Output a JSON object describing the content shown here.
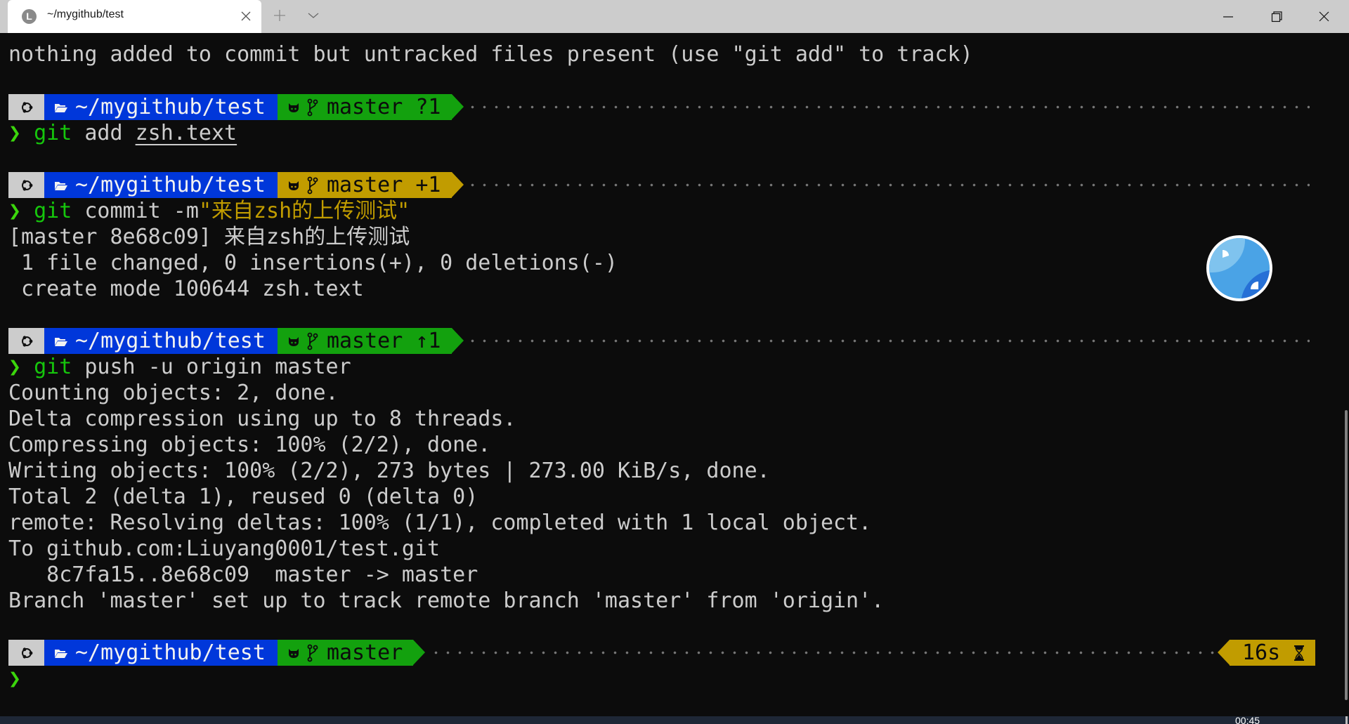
{
  "window": {
    "tab_title": "~/mygithub/test",
    "tab_icon_letter": "L",
    "close_tab_label": "×",
    "new_tab_label": "+",
    "controls": {
      "minimize": "minimize",
      "maximize": "restore",
      "close": "close"
    }
  },
  "terminal": {
    "lines": {
      "status": "nothing added to commit but untracked files present (use \"git add\" to track)",
      "commit_result": "[master 8e68c09] 来自zsh的上传测试",
      "files_changed": " 1 file changed, 0 insertions(+), 0 deletions(-)",
      "create_mode": " create mode 100644 zsh.text",
      "push_output": [
        "Counting objects: 2, done.",
        "Delta compression using up to 8 threads.",
        "Compressing objects: 100% (2/2), done.",
        "Writing objects: 100% (2/2), 273 bytes | 273.00 KiB/s, done.",
        "Total 2 (delta 1), reused 0 (delta 0)",
        "remote: Resolving deltas: 100% (1/1), completed with 1 local object.",
        "To github.com:Liuyang0001/test.git",
        "   8c7fa15..8e68c09  master -> master",
        "Branch 'master' set up to track remote branch 'master' from 'origin'."
      ]
    },
    "prompts": [
      {
        "path": "~/mygithub/test",
        "branch": "master",
        "status": " ?1",
        "color": "#13a10e",
        "command": {
          "git": "git",
          "rest": " add ",
          "arg": "zsh.text"
        }
      },
      {
        "path": "~/mygithub/test",
        "branch": "master",
        "status": " +1",
        "color": "#c19c00",
        "command": {
          "git": "git",
          "rest": " commit -m",
          "string": "\"来自zsh的上传测试\""
        }
      },
      {
        "path": "~/mygithub/test",
        "branch": "master",
        "status": " ↑1",
        "color": "#13a10e",
        "command": {
          "git": "git",
          "rest": " push -u origin master"
        }
      },
      {
        "path": "~/mygithub/test",
        "branch": "master",
        "status": "",
        "color": "#13a10e"
      }
    ],
    "prompt_char": "❯",
    "elapsed": "16s",
    "icons": {
      "os": "ubuntu-icon",
      "folder": "folder-icon",
      "github": "github-icon",
      "branch": "git-branch-icon",
      "timer": "hourglass-icon"
    }
  },
  "taskbar": {
    "clock": "00:45"
  },
  "colors": {
    "background": "#0c0c0c",
    "foreground": "#cccccc",
    "path_segment": "#0037da",
    "git_clean": "#13a10e",
    "git_dirty": "#c19c00",
    "os_segment": "#cccccc",
    "prompt_char": "#3bd60c"
  }
}
